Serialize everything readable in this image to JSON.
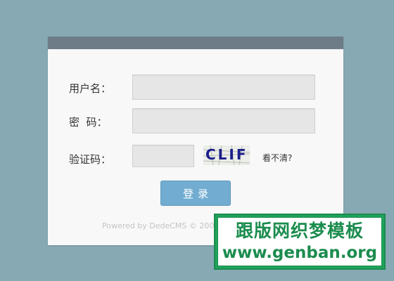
{
  "form": {
    "username_label": "用户名：",
    "username_value": "",
    "password_label": "密  码：",
    "password_value": "",
    "captcha_label": "验证码：",
    "captcha_value": "",
    "captcha_text": "CLIF",
    "refresh_label": "看不清?",
    "login_label": "登录"
  },
  "footer": {
    "text": "Powered by DedeCMS © 200"
  },
  "watermark": {
    "title": "跟版网织梦模板",
    "url": "www.genban.org"
  },
  "colors": {
    "page_background": "#87a9b3",
    "header_bar": "#6e7c88",
    "button": "#72add1",
    "watermark_green": "#1fa35b"
  }
}
